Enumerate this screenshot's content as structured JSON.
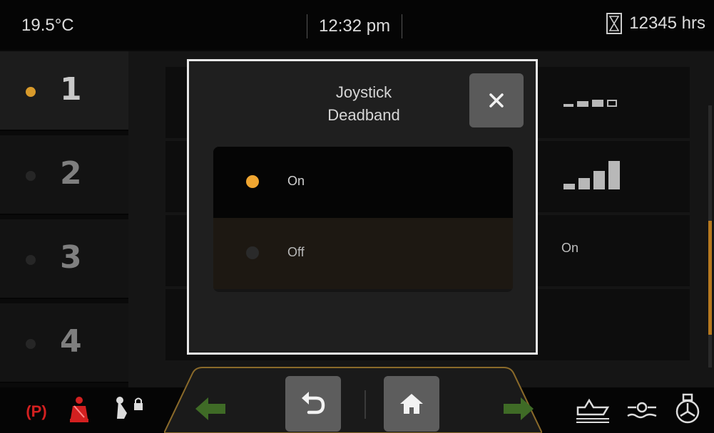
{
  "status_bar": {
    "temperature": "19.5°C",
    "time": "12:32 pm",
    "hours": "12345 hrs"
  },
  "channels": [
    {
      "label": "1",
      "active": true
    },
    {
      "label": "2",
      "active": false
    },
    {
      "label": "3",
      "active": false
    },
    {
      "label": "4",
      "active": false
    }
  ],
  "background": {
    "row3_value": "On"
  },
  "dialog": {
    "title_line1": "Joystick",
    "title_line2": "Deadband",
    "options": [
      {
        "label": "On",
        "selected": true
      },
      {
        "label": "Off",
        "selected": false
      }
    ]
  },
  "bottom_bar": {
    "park_label": "(P)"
  },
  "colors": {
    "accent": "#f0a631",
    "park_red": "#d32020",
    "arrow_green": "#3f6b26"
  },
  "icons": [
    "hourglass-icon",
    "close-icon",
    "back-icon",
    "home-icon",
    "left-arrow-icon",
    "right-arrow-icon",
    "park-brake-icon",
    "seat-belt-icon",
    "joystick-lock-icon",
    "boat-icon",
    "trim-icon",
    "engine-icon"
  ]
}
